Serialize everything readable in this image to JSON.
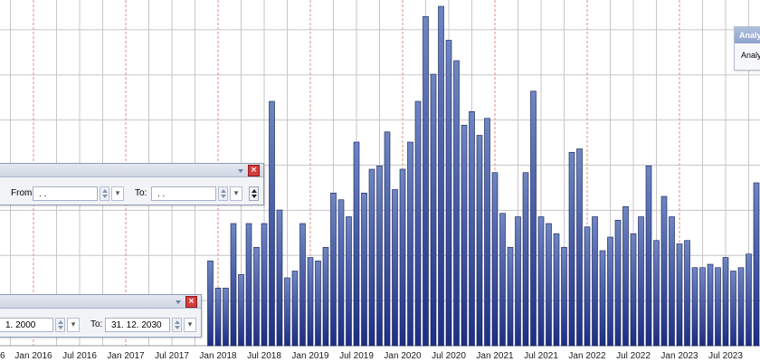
{
  "chart_data": {
    "type": "bar",
    "title": "",
    "xlabel": "",
    "ylabel": "",
    "ylim": [
      0,
      100
    ],
    "grid": true,
    "x_tick_labels": [
      "Jan 2016",
      "Jul 2016",
      "Jan 2017",
      "Jul 2017",
      "Jan 2018",
      "Jul 2018",
      "Jan 2019",
      "Jul 2019",
      "Jan 2020",
      "Jul 2020",
      "Jan 2021",
      "Jul 2021",
      "Jan 2022",
      "Jul 2022",
      "Jan 2023",
      "Jul 2023"
    ],
    "x_tick_partial_left": "6",
    "first_bar_month": "Dec 2017",
    "values": [
      25,
      17,
      17,
      36,
      21,
      36,
      29,
      36,
      72,
      40,
      20,
      22,
      36,
      26,
      25,
      29,
      45,
      43,
      38,
      60,
      45,
      52,
      53,
      63,
      46,
      52,
      60,
      72,
      97,
      80,
      100,
      90,
      84,
      65,
      69,
      62,
      67,
      51,
      39,
      29,
      38,
      51,
      75,
      38,
      36,
      33,
      29,
      57,
      58,
      35,
      38,
      28,
      32,
      37,
      41,
      33,
      38,
      53,
      31,
      44,
      38,
      30,
      31,
      23,
      23,
      24,
      23,
      26,
      22,
      23,
      27,
      48,
      16,
      18,
      66,
      18,
      18,
      18,
      23,
      21
    ]
  },
  "date_filter_panel": {
    "from_label": "From:",
    "from_value": ". .",
    "to_label": "To:",
    "to_value": ". ."
  },
  "date_range_panel": {
    "from_value": "1. 2000",
    "to_label": "To:",
    "to_value": "31. 12. 2030"
  },
  "analysis_panel": {
    "title": "Analy",
    "item": "Analy"
  },
  "colors": {
    "bar_top": "#6f86c2",
    "bar_bottom": "#1d2f85",
    "bar_edge": "#0f1a54",
    "grid": "#c7c7c7",
    "year_grid": "#e38b8b",
    "close_button": "#d43d3d"
  }
}
